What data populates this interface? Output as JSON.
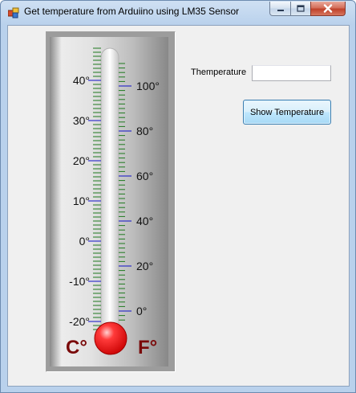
{
  "window": {
    "title": "Get temperature from Arduiino using LM35 Sensor",
    "icon": "windows-forms-app-icon",
    "controls": [
      "minimize-icon",
      "maximize-icon",
      "close-icon"
    ]
  },
  "thermometer": {
    "celsius_unit": "C°",
    "fahrenheit_unit": "F°",
    "celsius_labels": [
      "40°",
      "30°",
      "20°",
      "10°",
      "0°",
      "-10°",
      "-20°"
    ],
    "fahrenheit_labels": [
      "100°",
      "80°",
      "60°",
      "40°",
      "20°",
      "0°"
    ],
    "colors": {
      "minor_tick": "#1f7a1f",
      "major_tick": "#1010c8",
      "unit_text": "#7a0a0a",
      "bulb": "#ff2020"
    }
  },
  "form": {
    "temperature_label": "Themperature",
    "temperature_value": "",
    "show_button_label": "Show Temperature"
  }
}
